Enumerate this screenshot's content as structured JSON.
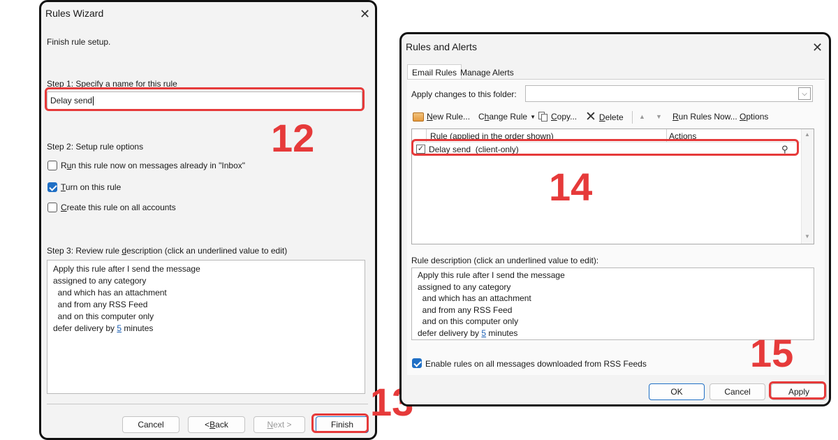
{
  "wizard": {
    "title": "Rules Wizard",
    "intro": "Finish rule setup.",
    "step1_pre": "Step 1: Specify a ",
    "step1_u": "n",
    "step1_post": "ame for this rule",
    "name_value": "Delay send",
    "step2_label": "Step 2: Setup rule options",
    "opt_run_pre": "R",
    "opt_run_u": "u",
    "opt_run_post": "n this rule now on messages already in \"Inbox\"",
    "opt_turn_u": "T",
    "opt_turn_post": "urn on this rule",
    "opt_create_u": "C",
    "opt_create_post": "reate this rule on all accounts",
    "step3_pre": "Step 3: Review rule ",
    "step3_u": "d",
    "step3_post": "escription (click an underlined value to edit)",
    "desc": {
      "l1": "Apply this rule after I send the message",
      "l2": "assigned to any category",
      "l3": "  and which has an attachment",
      "l4": "  and from any RSS Feed",
      "l5": "  and on this computer only",
      "l6_pre": "defer delivery by ",
      "l6_link": "5",
      "l6_post": " minutes"
    },
    "buttons": {
      "cancel": "Cancel",
      "back_pre": "< ",
      "back_u": "B",
      "back_post": "ack",
      "next_u": "N",
      "next_post": "ext >",
      "finish": "Finish"
    },
    "checks": {
      "run_now": false,
      "turn_on": true,
      "all_accounts": false
    }
  },
  "alerts": {
    "title": "Rules and Alerts",
    "tabs": [
      "Email Rules",
      "Manage Alerts"
    ],
    "folder_label": "Apply changes to this folder:",
    "folder_value": "",
    "toolbar": {
      "new_u": "N",
      "new_post": "ew Rule...",
      "change_pre": "C",
      "change_u": "h",
      "change_post": "ange Rule",
      "copy_u": "C",
      "copy_post": "opy...",
      "delete_u": "D",
      "delete_post": "elete",
      "run_u": "R",
      "run_post": "un Rules Now...",
      "options_u": "O",
      "options_post": "ptions"
    },
    "col_rule": "Rule (applied in the order shown)",
    "col_actions": "Actions",
    "rules": [
      {
        "name": "Delay send  (client-only)",
        "enabled": true
      }
    ],
    "desc_label": "Rule description (click an underlined value to edit):",
    "desc": {
      "l1": "Apply this rule after I send the message",
      "l2": "assigned to any category",
      "l3": "  and which has an attachment",
      "l4": "  and from any RSS Feed",
      "l5": "  and on this computer only",
      "l6_pre": "defer delivery by ",
      "l6_link": "5",
      "l6_post": " minutes"
    },
    "rss_label": "Enable rules on all messages downloaded from RSS Feeds",
    "rss_checked": true,
    "buttons": {
      "ok": "OK",
      "cancel": "Cancel",
      "apply": "Apply"
    }
  },
  "callouts": {
    "c12": "12",
    "c13": "13",
    "c14": "14",
    "c15": "15"
  },
  "colors": {
    "highlight": "#e63a3a",
    "accent": "#1f6fc5"
  },
  "icons": {
    "close": "close-icon",
    "new_rule": "new-rule-icon",
    "copy": "copy-icon",
    "delete": "delete-x-icon",
    "move_up": "arrow-up-icon",
    "move_down": "arrow-down-icon",
    "rule_actions": "rule-actions-icon",
    "dropdown": "chevron-down-icon"
  }
}
